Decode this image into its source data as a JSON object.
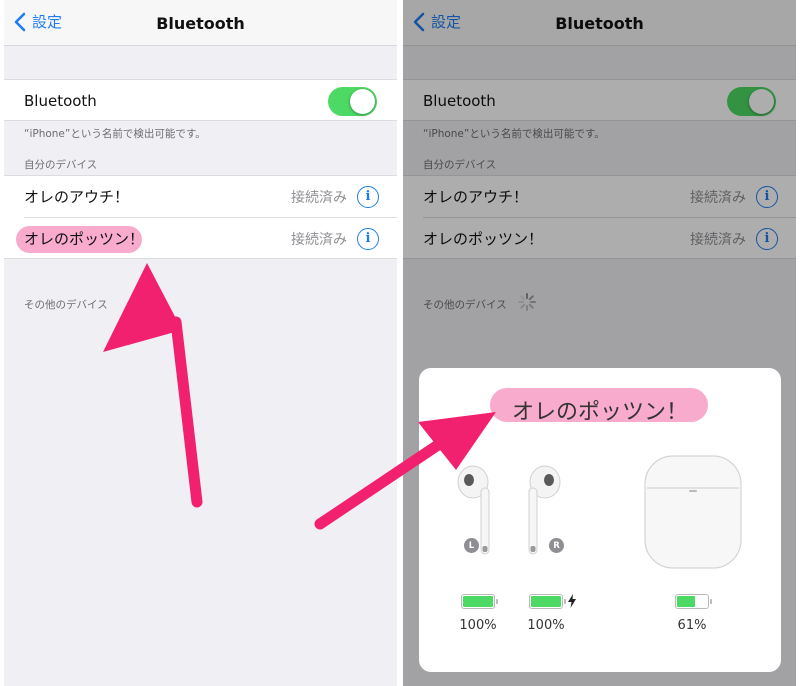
{
  "left": {
    "nav": {
      "back_label": "設定",
      "title": "Bluetooth"
    },
    "bluetooth_row": {
      "label": "Bluetooth",
      "toggle_on": true
    },
    "discoverable_note": "“iPhone”という名前で検出可能です。",
    "my_devices_header": "自分のデバイス",
    "devices": [
      {
        "name": "オレのアウチ！",
        "status": "接続済み"
      },
      {
        "name": "オレのポッツン！",
        "status": "接続済み"
      }
    ],
    "other_devices_header": "その他のデバイス"
  },
  "right": {
    "nav": {
      "back_label": "設定",
      "title": "Bluetooth"
    },
    "bluetooth_row": {
      "label": "Bluetooth",
      "toggle_on": true
    },
    "discoverable_note": "“iPhone”という名前で検出可能です。",
    "my_devices_header": "自分のデバイス",
    "devices": [
      {
        "name": "オレのアウチ！",
        "status": "接続済み"
      },
      {
        "name": "オレのポッツン！",
        "status": "接続済み"
      }
    ],
    "other_devices_header": "その他のデバイス",
    "popup": {
      "title": "オレのポッツン！",
      "left_badge": "L",
      "right_badge": "R",
      "left_battery": "100%",
      "right_battery": "100%",
      "case_battery": "61%",
      "left_level": 1.0,
      "right_level": 1.0,
      "case_level": 0.61
    }
  },
  "colors": {
    "accent": "#1e7cf2",
    "toggle_on": "#4cd964",
    "highlight": "#f7a2c8",
    "arrow": "#f2216f"
  }
}
